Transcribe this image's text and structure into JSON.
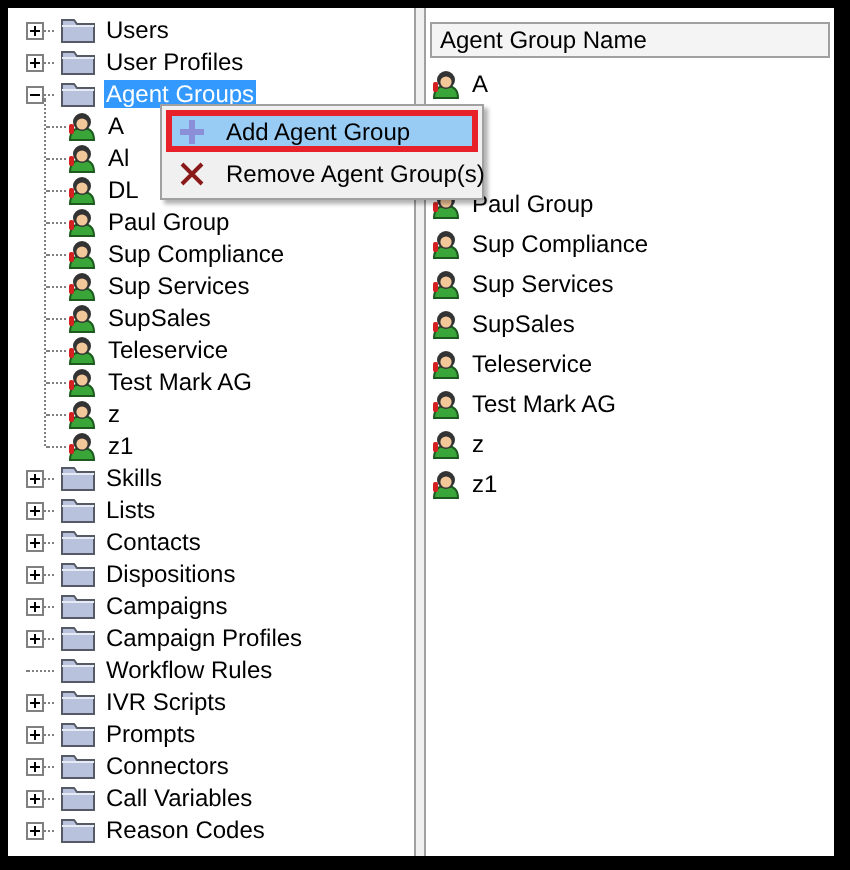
{
  "tree": [
    {
      "label": "Users",
      "expandable": true,
      "expanded": false,
      "selected": false
    },
    {
      "label": "User Profiles",
      "expandable": true,
      "expanded": false,
      "selected": false
    },
    {
      "label": "Agent Groups",
      "expandable": true,
      "expanded": true,
      "selected": true,
      "children": [
        {
          "label": "A"
        },
        {
          "label": "Al"
        },
        {
          "label": "DL"
        },
        {
          "label": "Paul Group"
        },
        {
          "label": "Sup Compliance"
        },
        {
          "label": "Sup Services"
        },
        {
          "label": "SupSales"
        },
        {
          "label": "Teleservice"
        },
        {
          "label": "Test Mark AG"
        },
        {
          "label": "z"
        },
        {
          "label": "z1"
        }
      ]
    },
    {
      "label": "Skills",
      "expandable": true,
      "expanded": false,
      "selected": false
    },
    {
      "label": "Lists",
      "expandable": true,
      "expanded": false,
      "selected": false
    },
    {
      "label": "Contacts",
      "expandable": true,
      "expanded": false,
      "selected": false
    },
    {
      "label": "Dispositions",
      "expandable": true,
      "expanded": false,
      "selected": false
    },
    {
      "label": "Campaigns",
      "expandable": true,
      "expanded": false,
      "selected": false
    },
    {
      "label": "Campaign Profiles",
      "expandable": true,
      "expanded": false,
      "selected": false
    },
    {
      "label": "Workflow Rules",
      "expandable": false,
      "selected": false
    },
    {
      "label": "IVR Scripts",
      "expandable": true,
      "expanded": false,
      "selected": false
    },
    {
      "label": "Prompts",
      "expandable": true,
      "expanded": false,
      "selected": false
    },
    {
      "label": "Connectors",
      "expandable": true,
      "expanded": false,
      "selected": false
    },
    {
      "label": "Call Variables",
      "expandable": true,
      "expanded": false,
      "selected": false
    },
    {
      "label": "Reason Codes",
      "expandable": true,
      "expanded": false,
      "selected": false
    }
  ],
  "list": {
    "column": "Agent Group Name",
    "rows": [
      {
        "kind": "item",
        "label": "A"
      },
      {
        "kind": "covered"
      },
      {
        "kind": "covered"
      },
      {
        "kind": "item",
        "label": "Paul Group"
      },
      {
        "kind": "item",
        "label": "Sup Compliance"
      },
      {
        "kind": "item",
        "label": "Sup Services"
      },
      {
        "kind": "item",
        "label": "SupSales"
      },
      {
        "kind": "item",
        "label": "Teleservice"
      },
      {
        "kind": "item",
        "label": "Test Mark AG"
      },
      {
        "kind": "item",
        "label": "z"
      },
      {
        "kind": "item",
        "label": "z1"
      }
    ]
  },
  "context_menu": [
    {
      "label": "Add Agent Group",
      "kind": "add",
      "selected": true
    },
    {
      "label": "Remove Agent Group(s)",
      "kind": "remove",
      "selected": false
    }
  ]
}
